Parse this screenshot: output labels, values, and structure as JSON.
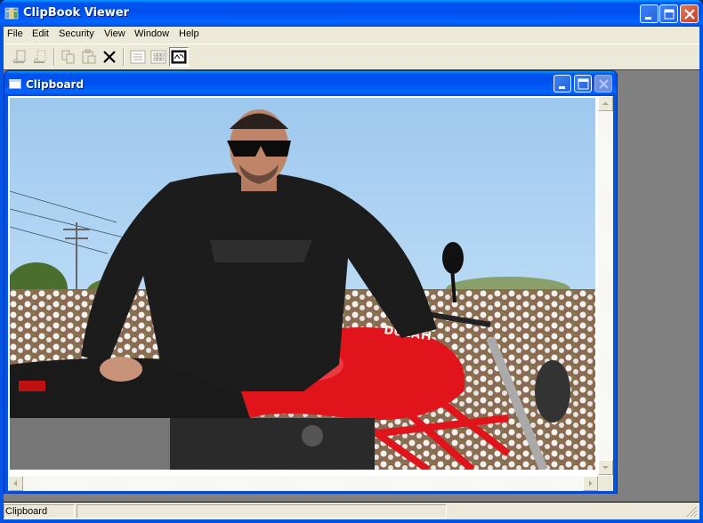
{
  "app": {
    "title": "ClipBook Viewer",
    "icon": "clipbook-icon",
    "caption_buttons": [
      "minimize",
      "maximize",
      "close"
    ]
  },
  "menu": {
    "items": [
      {
        "label": "File"
      },
      {
        "label": "Edit"
      },
      {
        "label": "Security"
      },
      {
        "label": "View"
      },
      {
        "label": "Window"
      },
      {
        "label": "Help"
      }
    ]
  },
  "toolbar": {
    "buttons": [
      {
        "name": "connect",
        "icon": "connect-icon",
        "enabled": false
      },
      {
        "name": "disconnect",
        "icon": "disconnect-icon",
        "enabled": false
      },
      {
        "name": "copy",
        "icon": "copy-icon",
        "enabled": false
      },
      {
        "name": "paste",
        "icon": "paste-icon",
        "enabled": false
      },
      {
        "name": "delete",
        "icon": "delete-x-icon",
        "enabled": true
      },
      {
        "name": "table-of-contents",
        "icon": "list-view-icon",
        "enabled": false
      },
      {
        "name": "thumbnails",
        "icon": "thumbnail-view-icon",
        "enabled": false
      },
      {
        "name": "full-page",
        "icon": "full-page-view-icon",
        "enabled": true,
        "pressed": true
      }
    ]
  },
  "child_window": {
    "title": "Clipboard",
    "caption_buttons": [
      "minimize",
      "maximize",
      "close-disabled"
    ],
    "content": {
      "type": "image",
      "description": "Photo: man in black jacket and sunglasses posing on a red Ducati motorcycle in front of a cotton field under blue sky",
      "text_on_image": "DUCATI"
    }
  },
  "statusbar": {
    "panes": [
      "Clipboard",
      ""
    ]
  }
}
